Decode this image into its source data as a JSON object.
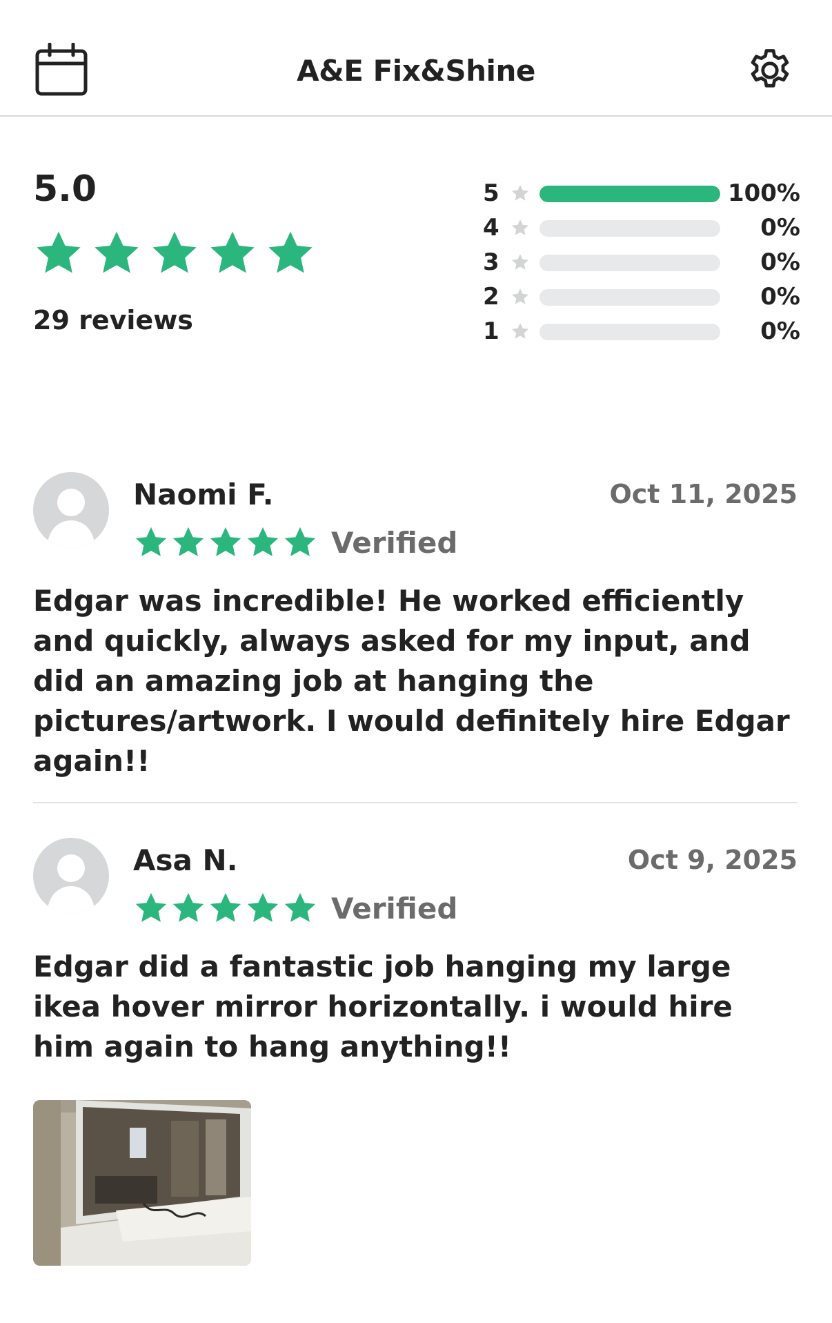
{
  "header": {
    "title": "A&E Fix&Shine",
    "left_icon": "calendar-icon",
    "right_icon": "gear-icon"
  },
  "summary": {
    "average": "5.0",
    "average_stars": 5,
    "reviews_label": "29 reviews",
    "distribution": [
      {
        "stars": "5",
        "percent_label": "100%",
        "fraction": 1.0
      },
      {
        "stars": "4",
        "percent_label": "0%",
        "fraction": 0
      },
      {
        "stars": "3",
        "percent_label": "0%",
        "fraction": 0
      },
      {
        "stars": "2",
        "percent_label": "0%",
        "fraction": 0
      },
      {
        "stars": "1",
        "percent_label": "0%",
        "fraction": 0
      }
    ]
  },
  "reviews": [
    {
      "name": "Naomi F.",
      "date": "Oct 11, 2025",
      "stars": 5,
      "verified_label": "Verified",
      "text": "Edgar was incredible! He worked efficiently and quickly, always asked for my input, and did an amazing job at hanging the pictures/artwork. I would definitely hire Edgar again!!"
    },
    {
      "name": "Asa N.",
      "date": "Oct 9, 2025",
      "stars": 5,
      "verified_label": "Verified",
      "text": "Edgar did a fantastic job hanging my large ikea hover mirror horizontally. i would hire him again to hang anything!!"
    }
  ],
  "colors": {
    "accent_green": "#2bb67e",
    "bar_track": "#e8e9ea",
    "muted_text": "#6b6b6b",
    "avatar_gray": "#d6d7d8"
  }
}
